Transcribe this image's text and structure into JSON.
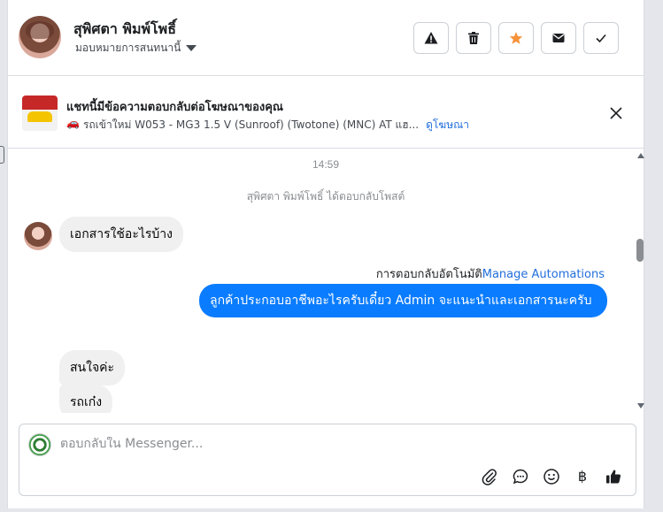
{
  "header": {
    "contact_name": "สุพิศตา พิมพ์โพธิ์",
    "assign_label": "มอบหมายการสนทนานี้",
    "actions": [
      {
        "name": "report-button",
        "icon": "warning-icon"
      },
      {
        "name": "delete-button",
        "icon": "trash-icon"
      },
      {
        "name": "star-button",
        "icon": "star-icon",
        "color": "#f7923a"
      },
      {
        "name": "mark-unread-button",
        "icon": "envelope-icon"
      },
      {
        "name": "mark-done-button",
        "icon": "check-icon"
      }
    ]
  },
  "ad_banner": {
    "title": "แชทนี้มีข้อความตอบกลับต่อโฆษณาของคุณ",
    "car_icon": "🚗",
    "description": "รถเข้าใหม่ W053 - MG3 1.5 V (Sunroof) (Twotone) (MNC) AT แฮ...",
    "link_label": "ดูโฆษณา"
  },
  "chat": {
    "timestamp": "14:59",
    "system_message": "สุพิศตา พิมพ์โพธิ์ ได้ตอบกลับโพสต์",
    "messages": [
      {
        "direction": "in",
        "text": "เอกสารใช้อะไรบ้าง"
      },
      {
        "direction": "out",
        "text": "ลูกค้าประกอบอาชีพอะไรครับเดี๋ยว Admin จะแนะนำและเอกสารนะครับ"
      },
      {
        "direction": "in",
        "text": "สนใจค่ะ"
      },
      {
        "direction": "in",
        "text": "รถเก๋ง"
      }
    ],
    "automation_label": "การตอบกลับอัตโนมัติ",
    "automation_link": "Manage Automations"
  },
  "composer": {
    "placeholder": "ตอบกลับใน Messenger...",
    "icons": [
      "paperclip-icon",
      "chat-bubble-icon",
      "emoji-icon",
      "baht-icon",
      "thumbs-up-icon"
    ],
    "baht_symbol": "฿"
  },
  "colors": {
    "accent": "#0a7cff",
    "link": "#216fdb",
    "star": "#f7923a"
  }
}
